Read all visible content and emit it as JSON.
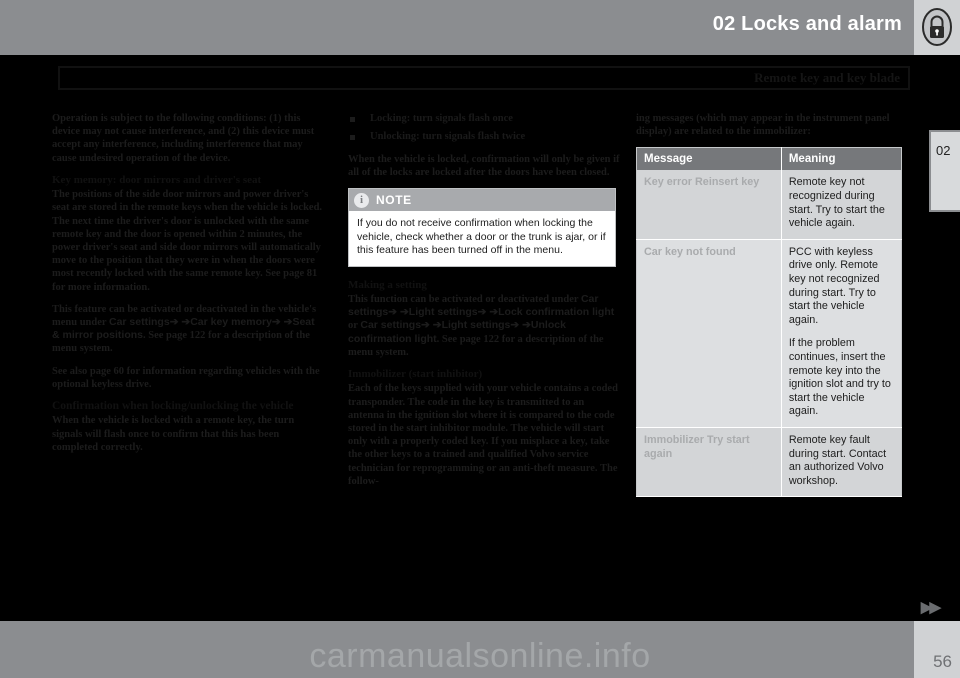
{
  "header": {
    "chapter_title": "02 Locks and alarm",
    "running_head": "Remote key and key blade",
    "lock_icon": "lock-icon",
    "chapter_tab": "02"
  },
  "footer": {
    "page_number": "56",
    "next_page_marker": "▶▶",
    "watermark": "carmanualsonline.info"
  },
  "column1": {
    "intro_paragraph": "Operation is subject to the following conditions: (1) this device may not cause interference, and (2) this device must accept any interference, including interference that may cause undesired operation of the device.",
    "heading_key_memory": "Key memory: door mirrors and driver's seat",
    "key_memory_p1": "The positions of the side door mirrors and power driver's seat are stored in the remote keys when the vehicle is locked. The next time the driver's door is unlocked with the same remote key and the door is opened within 2 minutes, the power driver's seat and side door mirrors will automatically move to the position that they were in when the doors were most recently locked with the same remote key. See page 81 for more information.",
    "key_memory_p2_pre": "This feature can be activated or deactivated in the vehicle's menu under ",
    "key_memory_menu1": "Car settings",
    "key_memory_arrow1": "➔ ➔",
    "key_memory_menu2": "Car key memory",
    "key_memory_arrow2": "➔ ➔",
    "key_memory_menu3": "Seat & mirror positions",
    "key_memory_p2_post": ". See page 122 for a description of the menu system.",
    "keyless_note": "See also page 60 for information regarding vehicles with the optional keyless drive.",
    "heading_confirmation": "Confirmation when locking/unlocking the vehicle",
    "confirmation_p1": "When the vehicle is locked with a remote key, the turn signals will flash once to confirm that this has been completed correctly."
  },
  "column2": {
    "bullets": [
      "Locking: turn signals flash once",
      "Unlocking: turn signals flash twice"
    ],
    "after_bullets": "When the vehicle is locked, confirmation will only be given if all of the locks are locked after the doors have been closed.",
    "note": {
      "icon": "info-icon",
      "title": "NOTE",
      "body": "If you do not receive confirmation when locking the vehicle, check whether a door or the trunk is ajar, or if this feature has been turned off in the menu."
    },
    "heading_making_setting": "Making a setting",
    "making_setting_pre": "This function can be activated or deactivated under ",
    "menu1": "Car settings",
    "arrow1": "➔ ➔",
    "menu2": "Light settings",
    "arrow2": "➔ ➔",
    "menu3": "Lock confirmation light",
    "or_text": " or ",
    "menu4": "Car settings",
    "arrow3": "➔ ➔",
    "menu5": "Light settings",
    "arrow4": "➔ ➔",
    "menu6": "Unlock confirmation light",
    "making_setting_post": ". See page 122 for a description of the menu system.",
    "heading_immobilizer": "Immobilizer (start inhibitor)",
    "immobilizer_p1": "Each of the keys supplied with your vehicle contains a coded transponder. The code in the key is transmitted to an antenna in the ignition slot where it is compared to the code stored in the start inhibitor module. The vehicle will start only with a properly coded key. If you misplace a key, take the other keys to a trained and qualified Volvo service technician for reprogramming or an anti-theft measure. The follow-"
  },
  "column3": {
    "continuation": "ing messages (which may appear in the instrument panel display) are related to the immobilizer:",
    "table": {
      "headers": [
        "Message",
        "Meaning"
      ],
      "rows": [
        {
          "message": "Key error Reinsert key",
          "meaning": [
            "Remote key not recognized during start. Try to start the vehicle again."
          ]
        },
        {
          "message": "Car key not found",
          "meaning": [
            "PCC with keyless drive only. Remote key not recognized during start. Try to start the vehicle again.",
            "If the problem continues, insert the remote key into the ignition slot and try to start the vehicle again."
          ]
        },
        {
          "message": "Immobilizer Try start again",
          "meaning": [
            "Remote key fault during start. Contact an authorized Volvo workshop."
          ]
        }
      ]
    }
  },
  "colors": {
    "band_gray": "#8b8d90",
    "tab_gray": "#d0d2d4",
    "table_header": "#76787b",
    "row_light": "#dddfe1",
    "row_dark": "#d3d5d7",
    "note_header": "#a8aaad"
  }
}
